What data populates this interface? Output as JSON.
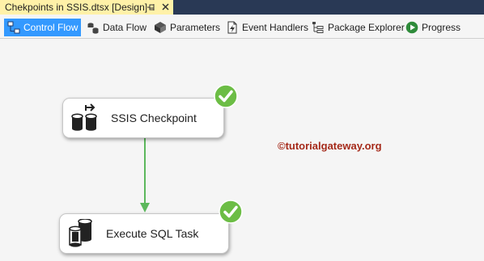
{
  "document_tab": {
    "title": "Chekpoints in SSIS.dtsx [Design]",
    "pin_icon": "pin-icon",
    "close_icon": "close-icon"
  },
  "designer_tabs": [
    {
      "label": "Control Flow",
      "icon": "control-flow-icon",
      "active": true
    },
    {
      "label": "Data Flow",
      "icon": "data-flow-icon",
      "active": false
    },
    {
      "label": "Parameters",
      "icon": "parameters-icon",
      "active": false
    },
    {
      "label": "Event Handlers",
      "icon": "event-handlers-icon",
      "active": false
    },
    {
      "label": "Package Explorer",
      "icon": "package-explorer-icon",
      "active": false
    },
    {
      "label": "Progress",
      "icon": "progress-icon",
      "active": false
    }
  ],
  "tasks": [
    {
      "label": "SSIS Checkpoint",
      "icon": "sequence-container-icon",
      "status": "success"
    },
    {
      "label": "Execute SQL Task",
      "icon": "execute-sql-task-icon",
      "status": "success"
    }
  ],
  "precedence_constraint": {
    "type": "success",
    "color": "#5cb85c"
  },
  "watermark": "©tutorialgateway.org",
  "colors": {
    "tab_strip_bg": "#293955",
    "document_tab_bg": "#fff1a8",
    "active_tab_bg": "#3399ff",
    "success_green": "#6cbd45",
    "watermark": "#a52a1a"
  }
}
